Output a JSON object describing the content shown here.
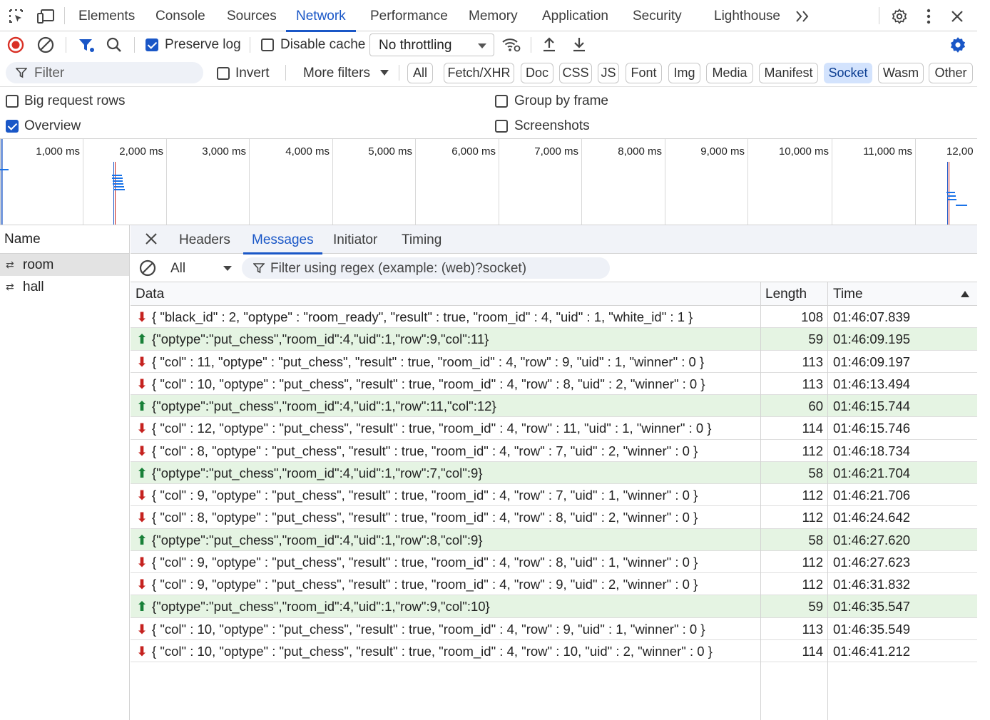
{
  "tabs": [
    {
      "label": "Elements"
    },
    {
      "label": "Console"
    },
    {
      "label": "Sources"
    },
    {
      "label": "Network",
      "active": true
    },
    {
      "label": "Performance"
    },
    {
      "label": "Memory"
    },
    {
      "label": "Application"
    },
    {
      "label": "Security"
    },
    {
      "label": "Lighthouse"
    }
  ],
  "toolbar": {
    "preserve_log": "Preserve log",
    "preserve_log_checked": true,
    "disable_cache": "Disable cache",
    "disable_cache_checked": false,
    "throttling": "No throttling"
  },
  "filter": {
    "placeholder": "Filter",
    "invert": "Invert",
    "more_filters": "More filters",
    "types": [
      "All",
      "Fetch/XHR",
      "Doc",
      "CSS",
      "JS",
      "Font",
      "Img",
      "Media",
      "Manifest",
      "Socket",
      "Wasm",
      "Other"
    ],
    "selected_type": "Socket"
  },
  "options": {
    "big_request_rows": "Big request rows",
    "group_by_frame": "Group by frame",
    "overview": "Overview",
    "screenshots": "Screenshots"
  },
  "overview_ticks": [
    "1,000 ms",
    "2,000 ms",
    "3,000 ms",
    "4,000 ms",
    "5,000 ms",
    "6,000 ms",
    "7,000 ms",
    "8,000 ms",
    "9,000 ms",
    "10,000 ms",
    "11,000 ms",
    "12,00"
  ],
  "requests": {
    "header": "Name",
    "items": [
      {
        "name": "room",
        "selected": true
      },
      {
        "name": "hall",
        "selected": false
      }
    ]
  },
  "detail": {
    "tabs": [
      "Headers",
      "Messages",
      "Initiator",
      "Timing"
    ],
    "active_tab": "Messages",
    "message_filter": "All",
    "regex_placeholder": "Filter using regex (example: (web)?socket)"
  },
  "messages": {
    "columns": {
      "data": "Data",
      "length": "Length",
      "time": "Time"
    },
    "rows": [
      {
        "dir": "received",
        "data": "{ \"black_id\" : 2, \"optype\" : \"room_ready\", \"result\" : true, \"room_id\" : 4, \"uid\" : 1, \"white_id\" : 1 }",
        "length": "108",
        "time": "01:46:07.839"
      },
      {
        "dir": "sent",
        "data": "{\"optype\":\"put_chess\",\"room_id\":4,\"uid\":1,\"row\":9,\"col\":11}",
        "length": "59",
        "time": "01:46:09.195"
      },
      {
        "dir": "received",
        "data": "{ \"col\" : 11, \"optype\" : \"put_chess\", \"result\" : true, \"room_id\" : 4, \"row\" : 9, \"uid\" : 1, \"winner\" : 0 }",
        "length": "113",
        "time": "01:46:09.197"
      },
      {
        "dir": "received",
        "data": "{ \"col\" : 10, \"optype\" : \"put_chess\", \"result\" : true, \"room_id\" : 4, \"row\" : 8, \"uid\" : 2, \"winner\" : 0 }",
        "length": "113",
        "time": "01:46:13.494"
      },
      {
        "dir": "sent",
        "data": "{\"optype\":\"put_chess\",\"room_id\":4,\"uid\":1,\"row\":11,\"col\":12}",
        "length": "60",
        "time": "01:46:15.744"
      },
      {
        "dir": "received",
        "data": "{ \"col\" : 12, \"optype\" : \"put_chess\", \"result\" : true, \"room_id\" : 4, \"row\" : 11, \"uid\" : 1, \"winner\" : 0 }",
        "length": "114",
        "time": "01:46:15.746"
      },
      {
        "dir": "received",
        "data": "{ \"col\" : 8, \"optype\" : \"put_chess\", \"result\" : true, \"room_id\" : 4, \"row\" : 7, \"uid\" : 2, \"winner\" : 0 }",
        "length": "112",
        "time": "01:46:18.734"
      },
      {
        "dir": "sent",
        "data": "{\"optype\":\"put_chess\",\"room_id\":4,\"uid\":1,\"row\":7,\"col\":9}",
        "length": "58",
        "time": "01:46:21.704"
      },
      {
        "dir": "received",
        "data": "{ \"col\" : 9, \"optype\" : \"put_chess\", \"result\" : true, \"room_id\" : 4, \"row\" : 7, \"uid\" : 1, \"winner\" : 0 }",
        "length": "112",
        "time": "01:46:21.706"
      },
      {
        "dir": "received",
        "data": "{ \"col\" : 8, \"optype\" : \"put_chess\", \"result\" : true, \"room_id\" : 4, \"row\" : 8, \"uid\" : 2, \"winner\" : 0 }",
        "length": "112",
        "time": "01:46:24.642"
      },
      {
        "dir": "sent",
        "data": "{\"optype\":\"put_chess\",\"room_id\":4,\"uid\":1,\"row\":8,\"col\":9}",
        "length": "58",
        "time": "01:46:27.620"
      },
      {
        "dir": "received",
        "data": "{ \"col\" : 9, \"optype\" : \"put_chess\", \"result\" : true, \"room_id\" : 4, \"row\" : 8, \"uid\" : 1, \"winner\" : 0 }",
        "length": "112",
        "time": "01:46:27.623"
      },
      {
        "dir": "received",
        "data": "{ \"col\" : 9, \"optype\" : \"put_chess\", \"result\" : true, \"room_id\" : 4, \"row\" : 9, \"uid\" : 2, \"winner\" : 0 }",
        "length": "112",
        "time": "01:46:31.832"
      },
      {
        "dir": "sent",
        "data": "{\"optype\":\"put_chess\",\"room_id\":4,\"uid\":1,\"row\":9,\"col\":10}",
        "length": "59",
        "time": "01:46:35.547"
      },
      {
        "dir": "received",
        "data": "{ \"col\" : 10, \"optype\" : \"put_chess\", \"result\" : true, \"room_id\" : 4, \"row\" : 9, \"uid\" : 1, \"winner\" : 0 }",
        "length": "113",
        "time": "01:46:35.549"
      },
      {
        "dir": "received",
        "data": "{ \"col\" : 10, \"optype\" : \"put_chess\", \"result\" : true, \"room_id\" : 4, \"row\" : 10, \"uid\" : 2, \"winner\" : 0 }",
        "length": "114",
        "time": "01:46:41.212"
      }
    ]
  },
  "colors": {
    "accent": "#1a57c7",
    "sent_row_bg": "#e5f4e3",
    "received_arrow": "#c5221f",
    "sent_arrow": "#188038",
    "record_stop": "#d93025"
  }
}
